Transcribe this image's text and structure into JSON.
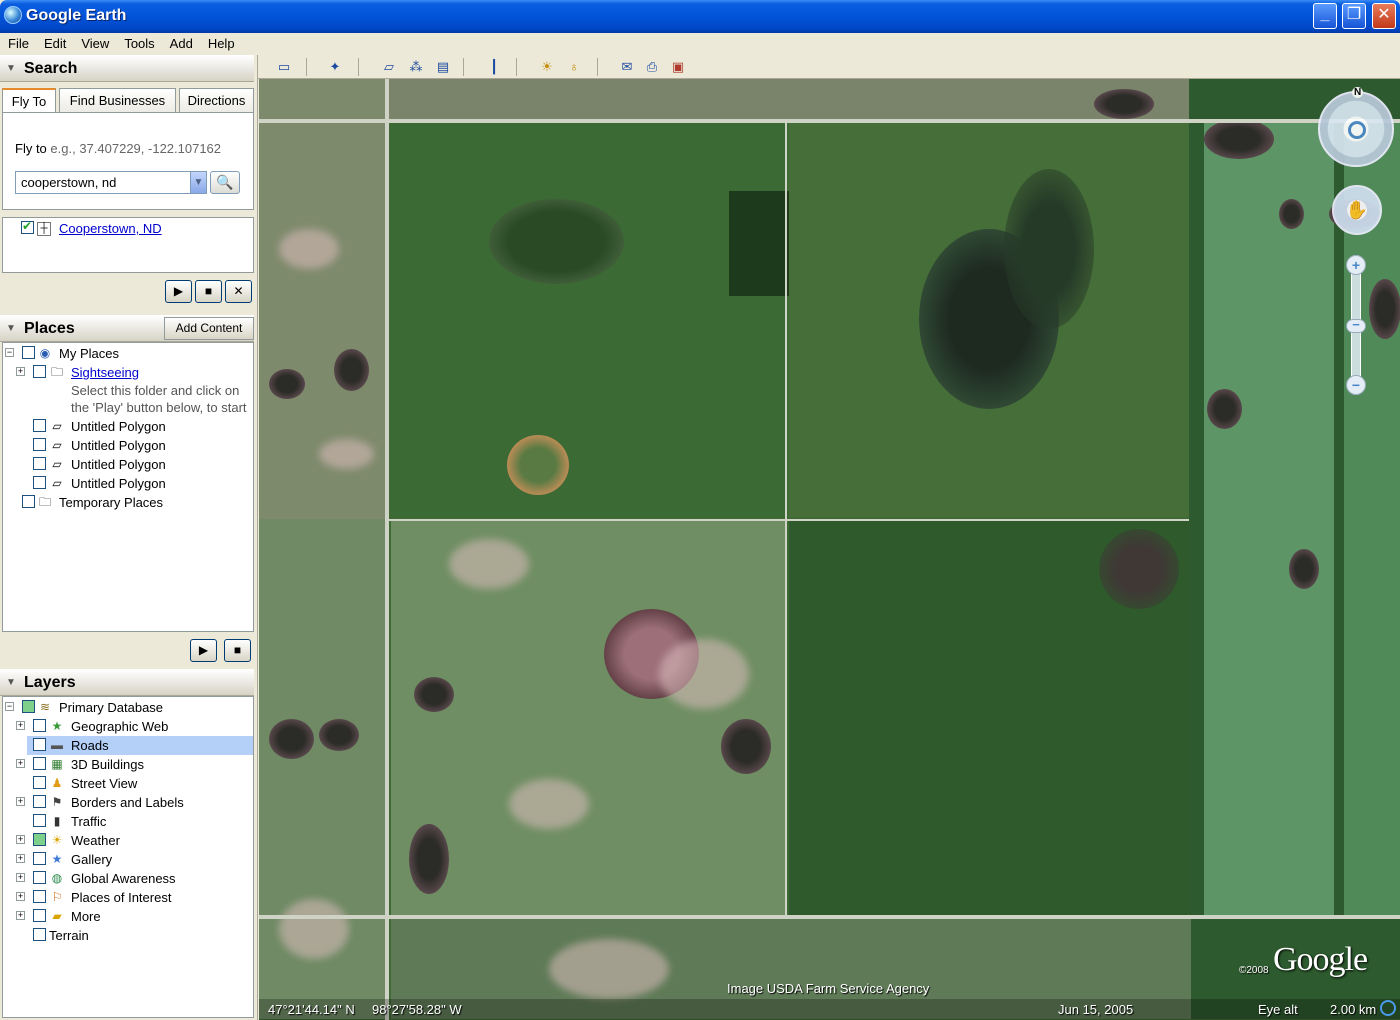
{
  "window": {
    "title": "Google Earth",
    "minimize": "_",
    "maximize": "❐",
    "close": "✕"
  },
  "menu": [
    "File",
    "Edit",
    "View",
    "Tools",
    "Add",
    "Help"
  ],
  "search": {
    "header": "Search",
    "tabs": [
      "Fly To",
      "Find Businesses",
      "Directions"
    ],
    "fly_label": "Fly to",
    "fly_hint": "e.g., 37.407229, -122.107162",
    "input_value": "cooperstown, nd",
    "result": "Cooperstown, ND"
  },
  "places": {
    "header": "Places",
    "add_content": "Add Content",
    "items": {
      "my_places": "My Places",
      "sightseeing": "Sightseeing",
      "sightseeing_desc1": "Select this folder and click on",
      "sightseeing_desc2": "the 'Play' button below, to start",
      "poly1": "Untitled Polygon",
      "poly2": "Untitled Polygon",
      "poly3": "Untitled Polygon",
      "poly4": "Untitled Polygon",
      "temp": "Temporary Places"
    }
  },
  "layers": {
    "header": "Layers",
    "items": {
      "primary": "Primary Database",
      "geoweb": "Geographic Web",
      "roads": "Roads",
      "buildings": "3D Buildings",
      "streetview": "Street View",
      "borders": "Borders and Labels",
      "traffic": "Traffic",
      "weather": "Weather",
      "gallery": "Gallery",
      "global": "Global Awareness",
      "poi": "Places of Interest",
      "more": "More",
      "terrain": "Terrain"
    }
  },
  "map": {
    "credit": "Image USDA Farm Service Agency",
    "logo": "Google",
    "logo_year": "©2008",
    "compass_n": "N",
    "lat": "47°21'44.14\" N",
    "lon": "98°27'58.28\" W",
    "date": "Jun 15, 2005",
    "eye_alt_label": "Eye alt",
    "eye_alt_value": "2.00 km"
  },
  "colors": {
    "titlebar": "#0353d8",
    "selection": "#b4d0f8",
    "link": "#0000cc"
  }
}
